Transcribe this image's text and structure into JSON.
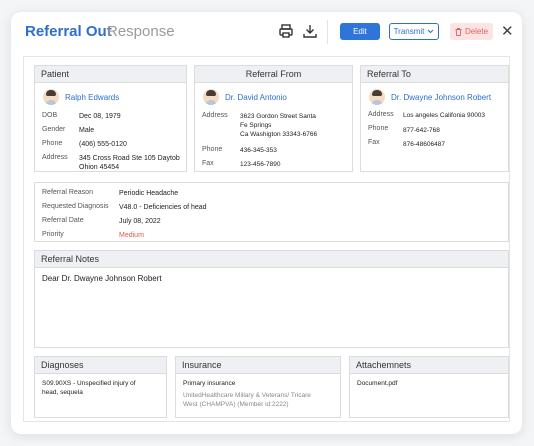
{
  "header": {
    "title": "Referral Out",
    "tab_response": "Response",
    "edit_label": "Edit",
    "transmit_label": "Transmit",
    "delete_label": "Delete",
    "close_label": "✕"
  },
  "patient": {
    "section_title": "Patient",
    "name": "Ralph Edwards",
    "dob_label": "DOB",
    "dob": "Dec 08, 1979",
    "gender_label": "Gender",
    "gender": "Male",
    "phone_label": "Phone",
    "phone": "(406) 555-0120",
    "address_label": "Address",
    "address_1": "345 Cross Road Ste 105 Daytob",
    "address_2": "Ohion 45454"
  },
  "referral_from": {
    "section_title": "Referral From",
    "name": "Dr. David Antonio",
    "address_label": "Address",
    "address_1": "3623 Gordon Street Santa",
    "address_2": "Fe Springs",
    "address_3": "Ca Washigton 33343-6766",
    "phone_label": "Phone",
    "phone": "436-345-353",
    "fax_label": "Fax",
    "fax": "123-456-7890"
  },
  "referral_to": {
    "section_title": "Referral To",
    "name": "Dr. Dwayne Johnson Robert",
    "address_label": "Address",
    "address": "Los angeles Califonia 90003",
    "phone_label": "Phone",
    "phone": "877-642-768",
    "fax_label": "Fax",
    "fax": "876-48606487"
  },
  "details": {
    "reason_label": "Referral Reason",
    "reason": "Periodic Headache",
    "diagnosis_label": "Requested Diagnosis",
    "diagnosis": "V48.0 - Deficiencies of head",
    "date_label": "Referral Date",
    "date": "July 08, 2022",
    "priority_label": "Priority",
    "priority": "Medium",
    "priority_color": "#e0594b"
  },
  "notes": {
    "section_title": "Referral Notes",
    "text": "Dear Dr. Dwayne Johnson Robert"
  },
  "diagnoses": {
    "section_title": "Diagnoses",
    "line_1": "S09.90XS - Unspecified injury of",
    "line_2": "head, sequela"
  },
  "insurance": {
    "section_title": "Insurance",
    "type": "Primary insurance",
    "line_1": "UnitedHealthcare Millary & Veterans/ Tricare",
    "line_2": "West (CHAMPVA) (Member id:2222)"
  },
  "attachments": {
    "section_title": "Attachemnets",
    "file": "Document.pdf"
  },
  "colors": {
    "accent": "#2f6fc9",
    "primary_button": "#2f74d8",
    "danger_bg": "#fde4e4",
    "danger_text": "#e06060"
  },
  "icons": [
    "printer-icon",
    "download-icon",
    "chevron-down-icon",
    "trash-icon",
    "close-icon",
    "avatar"
  ]
}
